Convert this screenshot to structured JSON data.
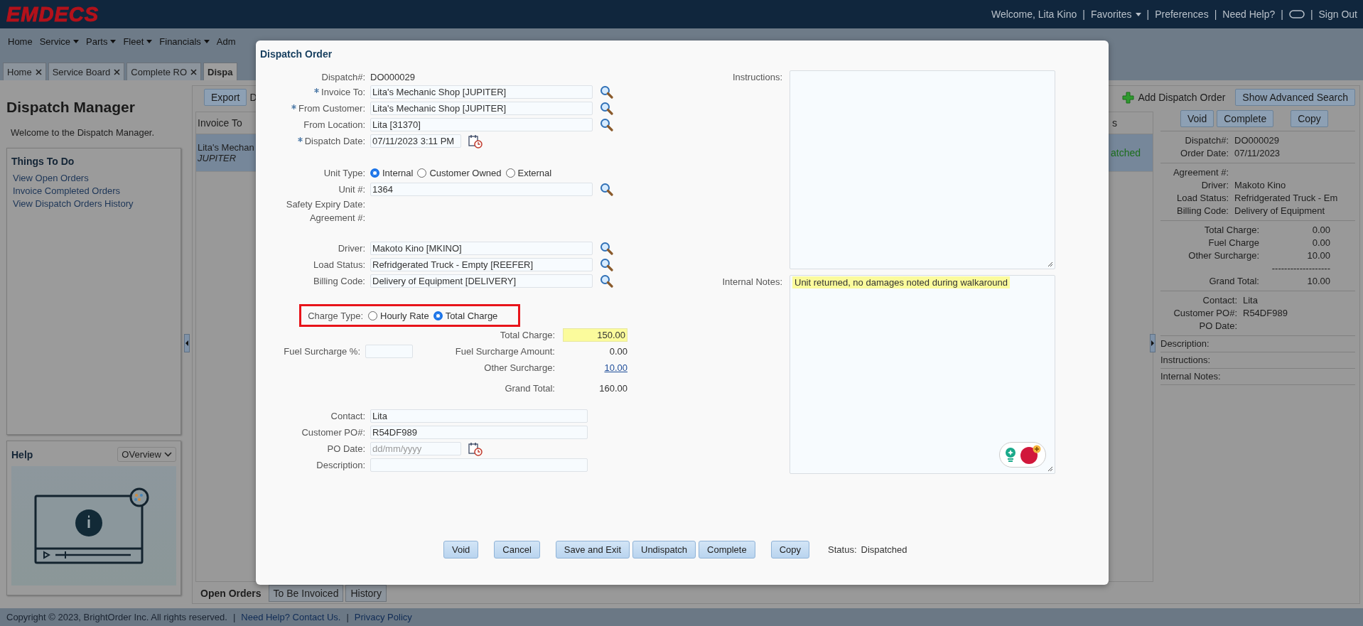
{
  "header": {
    "logo": "EMDECS",
    "links": [
      {
        "kind": "text",
        "label": "Welcome, Lita Kino"
      },
      {
        "kind": "separator",
        "label": "|"
      },
      {
        "kind": "menu",
        "label": "Favorites"
      },
      {
        "kind": "separator",
        "label": "|"
      },
      {
        "kind": "text",
        "label": "Preferences"
      },
      {
        "kind": "separator",
        "label": "|"
      },
      {
        "kind": "text",
        "label": "Need Help?"
      },
      {
        "kind": "separator",
        "label": "|"
      },
      {
        "kind": "icon"
      },
      {
        "kind": "separator",
        "label": "|"
      },
      {
        "kind": "text",
        "label": "Sign Out"
      }
    ]
  },
  "menu": [
    {
      "label": "Home",
      "has_menu": false
    },
    {
      "label": "Service",
      "has_menu": true
    },
    {
      "label": "Parts",
      "has_menu": true
    },
    {
      "label": "Fleet",
      "has_menu": true
    },
    {
      "label": "Financials",
      "has_menu": true
    },
    {
      "label": "Adm",
      "has_menu": false
    }
  ],
  "tabs": [
    {
      "label": "Home",
      "selected": false,
      "closable": true
    },
    {
      "label": "Service Board",
      "selected": false,
      "closable": true
    },
    {
      "label": "Complete RO",
      "selected": false,
      "closable": true
    },
    {
      "label": "Dispa",
      "selected": true,
      "closable": false
    }
  ],
  "sidebar": {
    "title": "Dispatch Manager",
    "welcome": "Welcome to the Dispatch Manager.",
    "todo_title": "Things To Do",
    "todo_links": [
      "View Open Orders",
      "Invoice Completed Orders",
      "View Dispatch Orders History"
    ],
    "help_title": "Help",
    "help_select": "OVerview"
  },
  "toolbar": {
    "export": "Export",
    "column_text": "D",
    "add": "Add Dispatch Order",
    "advanced_search": "Show Advanced Search"
  },
  "table": {
    "columns": [
      "Invoice To",
      "s"
    ],
    "rows": [
      {
        "selected": true,
        "invoice_to": "Lita's Mechan",
        "invoice_code": "JUPITER",
        "column_2": "atched"
      }
    ]
  },
  "detail_panel": {
    "buttons": [
      "Void",
      "Complete",
      "Copy"
    ],
    "sections": [
      {
        "kind": "fields",
        "rows": [
          {
            "label": "Dispatch#:",
            "value": "DO000029"
          },
          {
            "label": "Order Date:",
            "value": "07/11/2023"
          }
        ]
      },
      {
        "kind": "fields",
        "rows": [
          {
            "label": "Agreement #:"
          },
          {
            "label": "Driver:",
            "value": "Makoto Kino"
          },
          {
            "label": "Load Status:",
            "value": "Refridgerated Truck - Em"
          },
          {
            "label": "Billing Code:",
            "value": "Delivery of Equipment"
          }
        ]
      },
      {
        "kind": "amounts",
        "rows": [
          {
            "label": "Total Charge:",
            "value": "0.00"
          },
          {
            "label": "Fuel Charge",
            "value": "0.00"
          },
          {
            "label": "Other Surcharge:",
            "value": "10.00"
          },
          {
            "value": "-------------------"
          },
          {
            "label": "Grand Total:",
            "value": "10.00"
          }
        ]
      },
      {
        "kind": "contact",
        "rows": [
          {
            "label": "Contact:",
            "value": "Lita"
          },
          {
            "label": "Customer PO#:",
            "value": "R54DF989"
          },
          {
            "label": "PO Date:"
          }
        ]
      },
      {
        "kind": "notes",
        "rows": [
          {
            "label": "Description:"
          },
          {
            "label": "Instructions:"
          },
          {
            "label": "Internal Notes:"
          }
        ]
      }
    ]
  },
  "bottom_tabs": [
    {
      "label": "Open Orders",
      "selected": true
    },
    {
      "label": "To Be Invoiced",
      "selected": false
    },
    {
      "label": "History",
      "selected": false
    }
  ],
  "footer": [
    {
      "kind": "text",
      "label": "Copyright © 2023, BrightOrder Inc. All rights reserved."
    },
    {
      "kind": "separator",
      "label": "|"
    },
    {
      "kind": "link",
      "label": "Need Help? Contact Us."
    },
    {
      "kind": "separator",
      "label": "|"
    },
    {
      "kind": "link",
      "label": "Privacy Policy"
    }
  ],
  "dialog": {
    "title": "Dispatch Order",
    "groups": [
      [
        {
          "kind": "readonly",
          "label": "Dispatch#:",
          "value": "DO000029",
          "required": false
        },
        {
          "kind": "lookup",
          "label": "Invoice To:",
          "value": "Lita's Mechanic Shop [JUPITER]",
          "required": true
        },
        {
          "kind": "lookup",
          "label": "From Customer:",
          "value": "Lita's Mechanic Shop [JUPITER]",
          "required": true
        },
        {
          "kind": "lookup",
          "label": "From Location:",
          "value": "Lita [31370]",
          "required": false
        },
        {
          "kind": "date",
          "label": "Dispatch Date:",
          "value": "07/11/2023 3:11 PM",
          "required": true
        }
      ],
      [
        {
          "kind": "radio",
          "label": "Unit Type:",
          "options": [
            {
              "label": "Internal",
              "selected": true
            },
            {
              "label": "Customer Owned",
              "selected": false
            },
            {
              "label": "External",
              "selected": false
            }
          ],
          "required": false
        },
        {
          "kind": "lookup",
          "label": "Unit #:",
          "value": "1364",
          "required": false
        },
        {
          "kind": "label",
          "label": "Safety Expiry Date:",
          "required": false
        },
        {
          "kind": "label",
          "label": "Agreement #:",
          "required": false
        }
      ],
      [
        {
          "kind": "lookup",
          "label": "Driver:",
          "value": "Makoto Kino [MKINO]",
          "required": false
        },
        {
          "kind": "lookup",
          "label": "Load Status:",
          "value": "Refridgerated Truck - Empty [REEFER]",
          "required": false
        },
        {
          "kind": "lookup",
          "label": "Billing Code:",
          "value": "Delivery of Equipment [DELIVERY]",
          "required": false
        }
      ]
    ],
    "charge_type": {
      "label": "Charge Type:",
      "highlighted": true,
      "options": [
        {
          "label": "Hourly Rate",
          "selected": false
        },
        {
          "label": "Total Charge",
          "selected": true
        }
      ]
    },
    "charges": {
      "total_charge": {
        "label": "Total Charge:",
        "value": "150.00"
      },
      "fuel_surcharge_percent": {
        "label": "Fuel Surcharge %:"
      },
      "fuel_surcharge_amount": {
        "label": "Fuel Surcharge Amount:",
        "value": "0.00"
      },
      "other_surcharge": {
        "label": "Other Surcharge:",
        "value": "10.00"
      },
      "grand_total": {
        "label": "Grand Total:",
        "value": "160.00"
      }
    },
    "contact_fields": [
      {
        "kind": "input",
        "label": "Contact:",
        "value": "Lita",
        "required": false
      },
      {
        "kind": "input",
        "label": "Customer PO#:",
        "value": "R54DF989",
        "required": false
      },
      {
        "kind": "date",
        "label": "PO Date:",
        "placeholder": "dd/mm/yyyy",
        "required": false
      },
      {
        "kind": "input",
        "label": "Description:",
        "required": false
      }
    ],
    "instructions": {
      "label": "Instructions:"
    },
    "internal_notes": {
      "label": "Internal Notes:",
      "value": "Unit returned, no damages noted during walkaround"
    },
    "button_groups": [
      [
        "Void"
      ],
      [
        "Cancel"
      ],
      [
        "Save and Exit",
        "Undispatch",
        "Complete"
      ],
      [
        "Copy"
      ]
    ],
    "status": {
      "label": "Status:",
      "value": "Dispatched"
    }
  }
}
